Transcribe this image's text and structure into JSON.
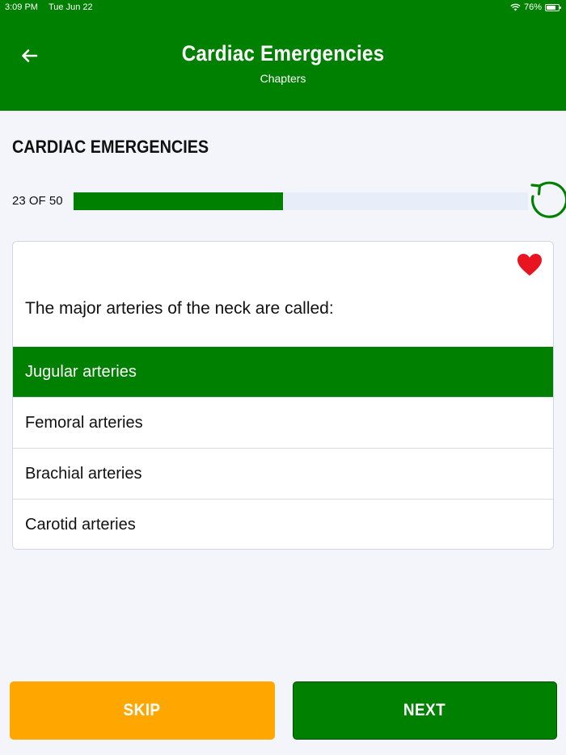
{
  "status_bar": {
    "time": "3:09 PM",
    "date": "Tue Jun 22",
    "battery": "76%",
    "battery_level": 0.76
  },
  "header": {
    "title": "Cardiac Emergencies",
    "subtitle": "Chapters",
    "back_icon": "arrow-left-icon"
  },
  "section": {
    "title": "CARDIAC EMERGENCIES"
  },
  "progress": {
    "label": "23 OF 50",
    "current": 23,
    "total": 50,
    "fraction": 0.46
  },
  "question": {
    "text": "The major arteries of the neck are called:",
    "favorite_icon": "heart-icon",
    "options": [
      {
        "label": "Jugular arteries",
        "selected": true
      },
      {
        "label": "Femoral arteries",
        "selected": false
      },
      {
        "label": "Brachial arteries",
        "selected": false
      },
      {
        "label": "Carotid arteries",
        "selected": false
      }
    ]
  },
  "buttons": {
    "skip": "SKIP",
    "next": "NEXT"
  },
  "colors": {
    "primary": "#008000",
    "skip": "#ffa700",
    "favorite": "#e8141f",
    "background": "#f4f5fa"
  }
}
